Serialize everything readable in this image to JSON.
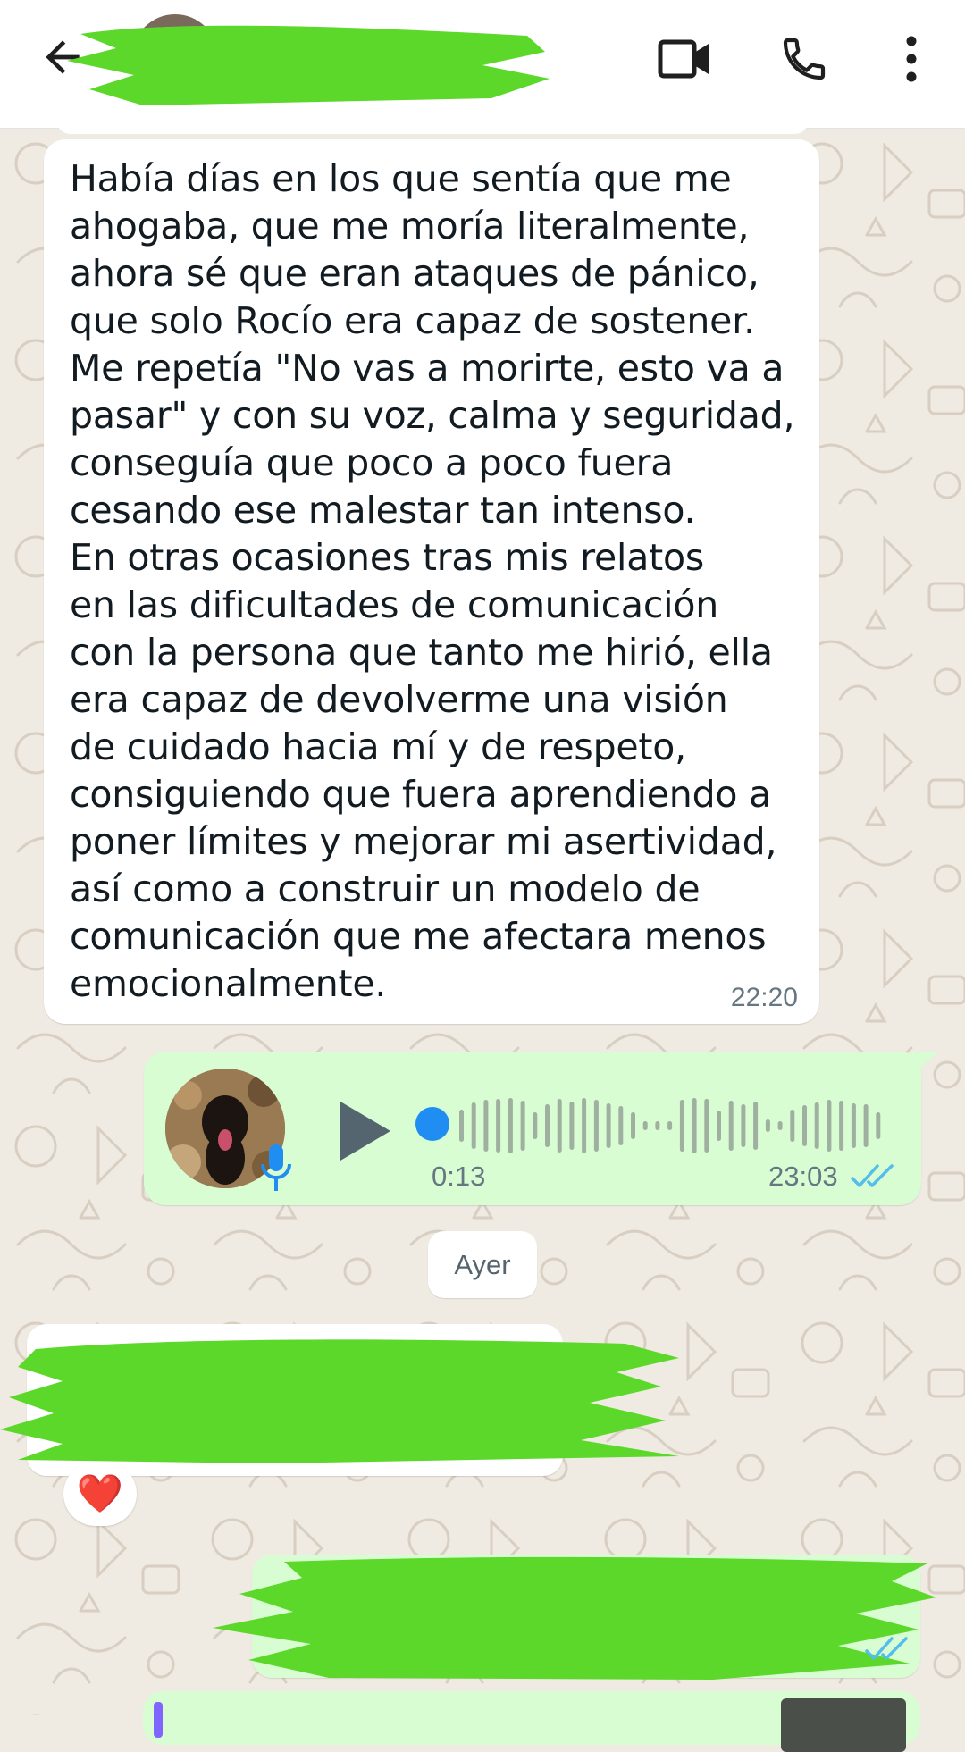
{
  "header": {
    "back_label": "Back",
    "contact_name": "",
    "icons": [
      "arrow-left-icon",
      "video-camera-icon",
      "phone-icon",
      "more-vertical-icon"
    ]
  },
  "messages": {
    "incoming_1": {
      "text": "Había días en los que sentía que me\nahogaba, que me moría literalmente,\nahora sé que eran ataques de pánico,\nque solo Rocío era capaz de sostener.\nMe repetía \"No vas a morirte, esto va a\npasar\" y con su voz, calma y seguridad,\nconseguía que poco a poco fuera\ncesando ese malestar tan intenso.\nEn otras ocasiones tras mis relatos\nen las dificultades de comunicación\ncon la persona que tanto me hirió, ella\nera capaz de devolverme una visión\nde cuidado hacia mí y de respeto,\nconsiguiendo que fuera aprendiendo a\nponer límites y mejorar mi asertividad,\nasí como a construir un modelo de\ncomunicación que me afectara menos\nemocionalmente.",
      "time": "22:20"
    },
    "outgoing_audio": {
      "duration": "0:13",
      "time": "23:03",
      "progress": 0,
      "status": "read"
    },
    "date_separator": "Ayer",
    "incoming_2": {
      "text": "",
      "reaction": "❤️"
    },
    "outgoing_2": {
      "text": "",
      "status": "read"
    }
  },
  "colors": {
    "outgoing_bubble": "#d9fdd3",
    "incoming_bubble": "#ffffff",
    "background": "#efeae2",
    "read_ticks": "#53bdeb",
    "redaction": "#5bd82a"
  }
}
